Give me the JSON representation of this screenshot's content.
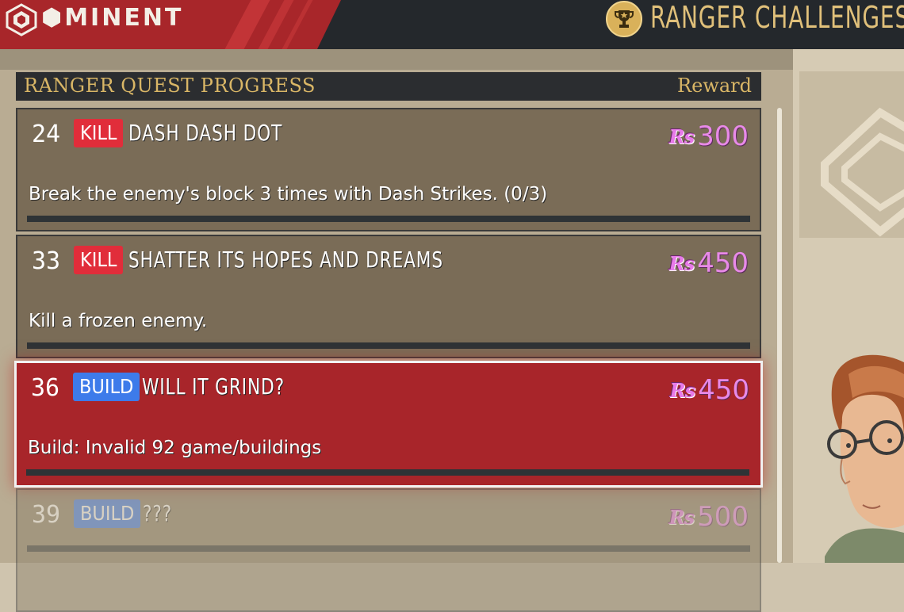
{
  "topbar": {
    "brand": "MINENT",
    "brand_icon": "hexagon-logo-icon",
    "title": "RANGER CHALLENGES",
    "title_icon": "trophy-icon"
  },
  "header": {
    "title": "RANGER QUEST PROGRESS",
    "reward_label": "Reward"
  },
  "currency": {
    "symbol": "Rs",
    "color": "#e88ae8"
  },
  "quests": [
    {
      "number": "24",
      "type": "KILL",
      "type_color": "#e12d3a",
      "name": "DASH DASH DOT",
      "reward": "300",
      "description": "Break the enemy's block 3 times with Dash Strikes. (0/3)",
      "progress": 0,
      "state": "normal"
    },
    {
      "number": "33",
      "type": "KILL",
      "type_color": "#e12d3a",
      "name": "SHATTER ITS HOPES AND DREAMS",
      "reward": "450",
      "description": "Kill a frozen enemy.",
      "progress": 0,
      "state": "normal"
    },
    {
      "number": "36",
      "type": "BUILD",
      "type_color": "#3d7bea",
      "name": "WILL IT GRIND?",
      "reward": "450",
      "description": "Build: Invalid 92 game/buildings",
      "progress": 0,
      "state": "selected"
    },
    {
      "number": "39",
      "type": "BUILD",
      "type_color": "#3d7bea",
      "name": "???",
      "reward": "500",
      "description": "",
      "progress": 0,
      "state": "locked"
    }
  ],
  "colors": {
    "topbar_bg": "#24282c",
    "brand_red": "#a8262a",
    "gold_text": "#d9b666",
    "card_bg": "#7a6c57",
    "selected_bg": "#a8252a"
  }
}
